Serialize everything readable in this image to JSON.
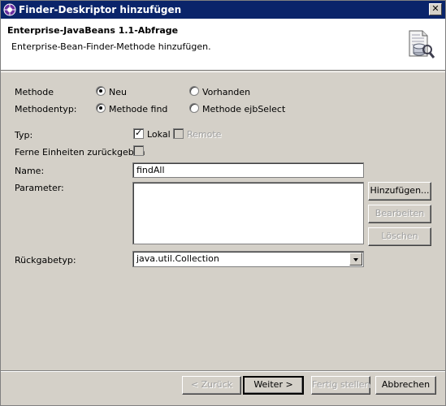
{
  "window": {
    "title": "Finder-Deskriptor hinzufügen"
  },
  "banner": {
    "title": "Enterprise-JavaBeans 1.1-Abfrage",
    "description": "Enterprise-Bean-Finder-Methode hinzufügen."
  },
  "form": {
    "methode_label": "Methode",
    "methode_options": [
      "Neu",
      "Vorhanden"
    ],
    "methode_selected": "Neu",
    "methodentyp_label": "Methodentyp:",
    "methodentyp_options": [
      "Methode find",
      "Methode ejbSelect"
    ],
    "methodentyp_selected": "Methode find",
    "typ_label": "Typ:",
    "typ_lokal_label": "Lokal",
    "typ_lokal_checked": true,
    "typ_remote_label": "Remote",
    "typ_remote_checked": false,
    "ferne_label": "Ferne Einheiten zurückgeben",
    "ferne_checked": false,
    "name_label": "Name:",
    "name_value": "findAll",
    "parameter_label": "Parameter:",
    "param_buttons": [
      "Hinzufügen...",
      "Bearbeiten",
      "Löschen"
    ],
    "rueckgabetyp_label": "Rückgabetyp:",
    "rueckgabetyp_value": "java.util.Collection"
  },
  "footer": {
    "back_label": "< Zurück",
    "next_label": "Weiter >",
    "finish_label": "Fertig stellen",
    "cancel_label": "Abbrechen"
  }
}
